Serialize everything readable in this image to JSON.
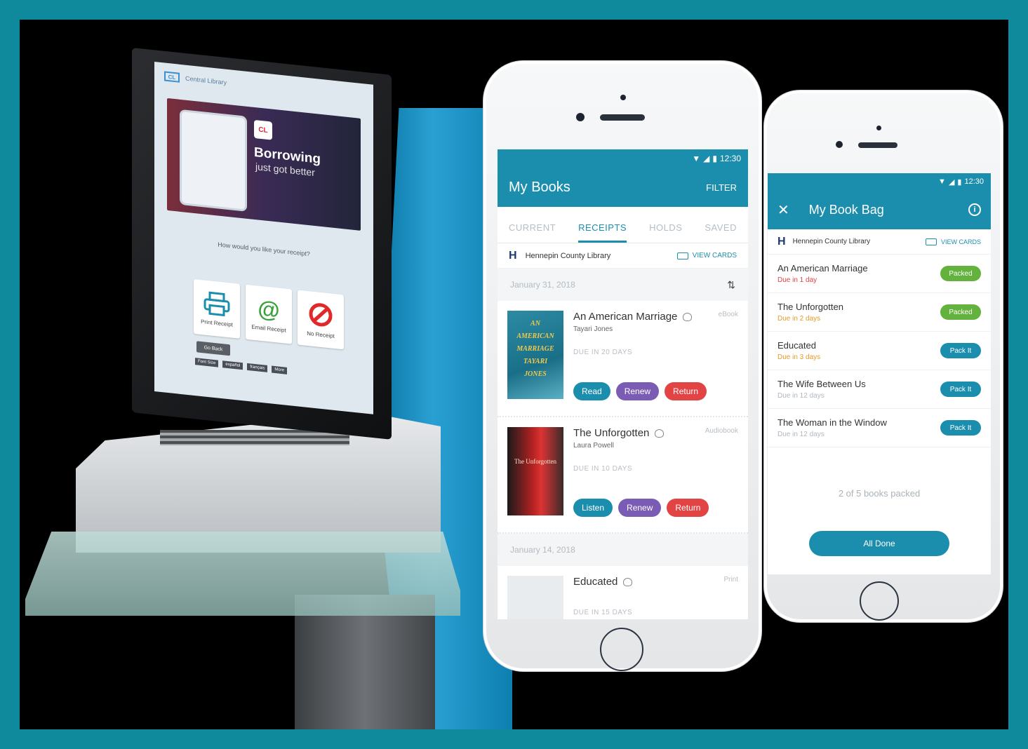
{
  "colors": {
    "frame": "#0e8a9c",
    "teal": "#1c8ead",
    "purple": "#7a5cb5",
    "red": "#e24343",
    "green": "#62b23d",
    "orange": "#e69a2a",
    "duered": "#e24343"
  },
  "kiosk": {
    "library_name": "Central Library",
    "logo": "CL",
    "banner_logo": "CL",
    "headline": "Borrowing",
    "subheadline": "just got better",
    "question": "How would you like your receipt?",
    "options": [
      {
        "label": "Print Receipt",
        "icon": "printer-icon"
      },
      {
        "label": "Email Receipt",
        "icon": "email-at-icon"
      },
      {
        "label": "No Receipt",
        "icon": "no-receipt-icon"
      }
    ],
    "go_back": "Go Back",
    "footer": [
      "Font Size",
      "español",
      "français",
      "More"
    ]
  },
  "phone1": {
    "status_time": "12:30",
    "title": "My Books",
    "filter": "FILTER",
    "tabs": [
      {
        "label": "CURRENT"
      },
      {
        "label": "RECEIPTS"
      },
      {
        "label": "HOLDS"
      },
      {
        "label": "SAVED"
      }
    ],
    "active_tab": "RECEIPTS",
    "library": "Hennepin County Library",
    "library_icon": "H",
    "view_cards": "VIEW CARDS",
    "sort_icon": "⇅",
    "date1": "January 31, 2018",
    "date2": "January 14, 2018",
    "books": [
      {
        "title": "An American Marriage",
        "author": "Tayari Jones",
        "format": "eBook",
        "due": "DUE IN 20 DAYS",
        "cover_text": "AN AMERICAN MARRIAGE TAYARI JONES",
        "actions": [
          {
            "label": "Read",
            "color": "blue"
          },
          {
            "label": "Renew",
            "color": "purple"
          },
          {
            "label": "Return",
            "color": "red"
          }
        ]
      },
      {
        "title": "The Unforgotten",
        "author": "Laura Powell",
        "format": "Audiobook",
        "due": "DUE IN 10 DAYS",
        "cover_text": "The Unforgotten",
        "actions": [
          {
            "label": "Listen",
            "color": "blue"
          },
          {
            "label": "Renew",
            "color": "purple"
          },
          {
            "label": "Return",
            "color": "red"
          }
        ]
      },
      {
        "title": "Educated",
        "author": "",
        "format": "Print",
        "due": "DUE IN 15 DAYS"
      }
    ]
  },
  "phone2": {
    "status_time": "12:30",
    "title": "My Book Bag",
    "library": "Hennepin County Library",
    "library_icon": "H",
    "view_cards": "VIEW CARDS",
    "items": [
      {
        "title": "An American Marriage",
        "due": "Due in 1 day",
        "due_color": "#e24343",
        "button": "Packed",
        "state": "packed"
      },
      {
        "title": "The Unforgotten",
        "due": "Due in 2 days",
        "due_color": "#e69a2a",
        "button": "Packed",
        "state": "packed"
      },
      {
        "title": "Educated",
        "due": "Due in 3 days",
        "due_color": "#e69a2a",
        "button": "Pack It",
        "state": "pack"
      },
      {
        "title": "The Wife Between Us",
        "due": "Due in 12 days",
        "due_color": "#b0b8bf",
        "button": "Pack It",
        "state": "pack"
      },
      {
        "title": "The Woman in the Window",
        "due": "Due in 12 days",
        "due_color": "#b0b8bf",
        "button": "Pack It",
        "state": "pack"
      }
    ],
    "summary": "2 of 5 books packed",
    "done": "All Done"
  }
}
